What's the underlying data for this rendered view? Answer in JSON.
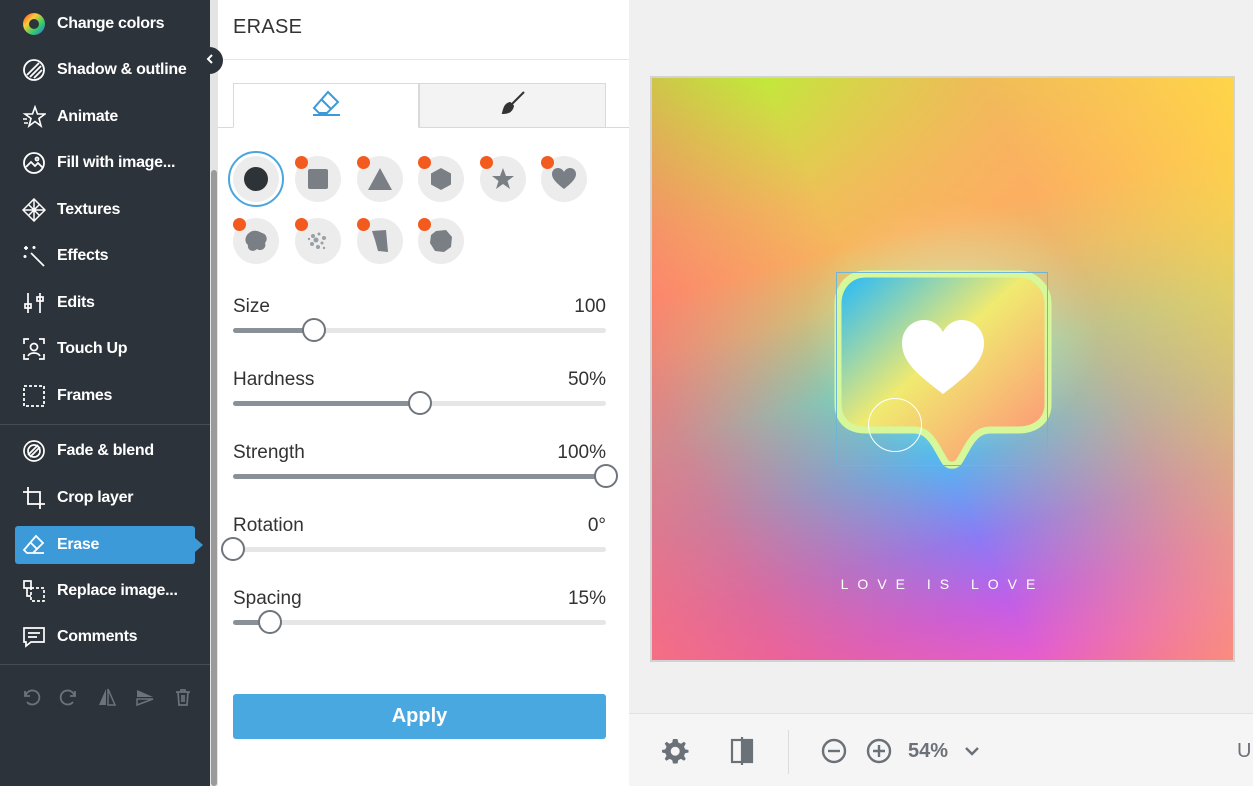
{
  "sidebar": {
    "items": [
      {
        "label": "Change colors",
        "icon": "color-wheel-icon"
      },
      {
        "label": "Shadow & outline",
        "icon": "shadow-icon"
      },
      {
        "label": "Animate",
        "icon": "star-icon"
      },
      {
        "label": "Fill with image...",
        "icon": "image-fill-icon"
      },
      {
        "label": "Textures",
        "icon": "texture-icon"
      },
      {
        "label": "Effects",
        "icon": "magic-wand-icon"
      },
      {
        "label": "Edits",
        "icon": "sliders-icon"
      },
      {
        "label": "Touch Up",
        "icon": "face-scan-icon"
      },
      {
        "label": "Frames",
        "icon": "frame-icon"
      },
      {
        "label": "Fade & blend",
        "icon": "blend-icon"
      },
      {
        "label": "Crop layer",
        "icon": "crop-icon"
      },
      {
        "label": "Erase",
        "icon": "eraser-icon",
        "active": true
      },
      {
        "label": "Replace image...",
        "icon": "replace-icon"
      },
      {
        "label": "Comments",
        "icon": "comment-icon"
      }
    ],
    "bottom_icons": [
      "undo-icon",
      "redo-icon",
      "flip-horizontal-icon",
      "flip-vertical-icon",
      "trash-icon"
    ]
  },
  "panel": {
    "title": "ERASE",
    "tabs": [
      "eraser-icon",
      "brush-icon"
    ],
    "brush_shapes": [
      "circle",
      "square",
      "triangle",
      "hexagon",
      "star",
      "heart",
      "blob",
      "spray",
      "shard",
      "splat"
    ],
    "sliders": [
      {
        "name": "Size",
        "value": "100",
        "fraction": 0.218
      },
      {
        "name": "Hardness",
        "value": "50%",
        "fraction": 0.5
      },
      {
        "name": "Strength",
        "value": "100%",
        "fraction": 1.0
      },
      {
        "name": "Rotation",
        "value": "0°",
        "fraction": 0.0
      },
      {
        "name": "Spacing",
        "value": "15%",
        "fraction": 0.1
      }
    ],
    "apply_label": "Apply"
  },
  "canvas": {
    "tagline": "LOVE IS LOVE"
  },
  "toolbar": {
    "zoom": "54%",
    "truncated_text": "U",
    "icons": [
      "gear-icon",
      "compare-icon",
      "zoom-out-icon",
      "zoom-in-icon",
      "chevron-down-icon"
    ]
  },
  "colors": {
    "accent": "#3d9ad9",
    "sidebar_bg": "#2d333b",
    "apply_bg": "#4aa8e0",
    "pro_dot": "#f25a1e"
  }
}
